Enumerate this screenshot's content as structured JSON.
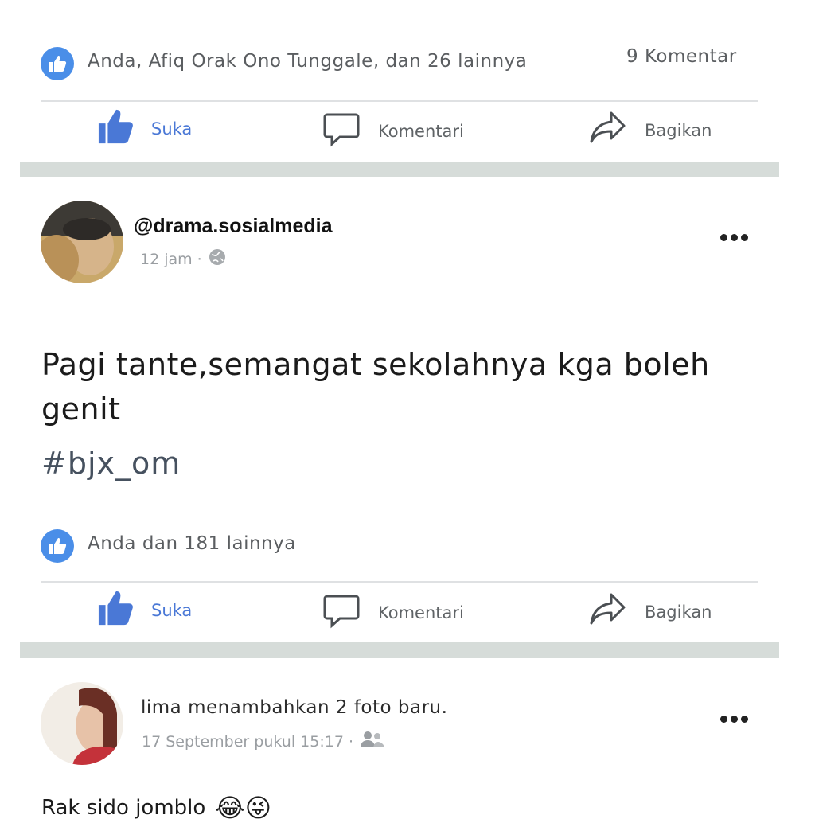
{
  "post_top": {
    "reaction_summary": "Anda, Afiq Orak Ono Tunggale, dan 26 lainnya",
    "comment_count": "9 Komentar",
    "actions": {
      "like": "Suka",
      "comment": "Komentari",
      "share": "Bagikan"
    }
  },
  "post_main": {
    "author": "@drama.sosialmedia",
    "time": "12 jam ·",
    "privacy_icon": "globe-icon",
    "text": "Pagi tante,semangat sekolahnya kga boleh genit",
    "hashtag": "#bjx_om",
    "reaction_summary": "Anda dan 181 lainnya",
    "actions": {
      "like": "Suka",
      "comment": "Komentari",
      "share": "Bagikan"
    }
  },
  "post_bottom": {
    "headline": "lima menambahkan 2 foto baru.",
    "time": "17 September pukul 15:17 ·",
    "privacy_icon": "friends-icon",
    "text": "Rak sido jomblo",
    "emoji": "😂😜"
  },
  "colors": {
    "accent": "#4a8ee8",
    "like_text": "#4a78d6",
    "separator": "#d6dcd9"
  }
}
